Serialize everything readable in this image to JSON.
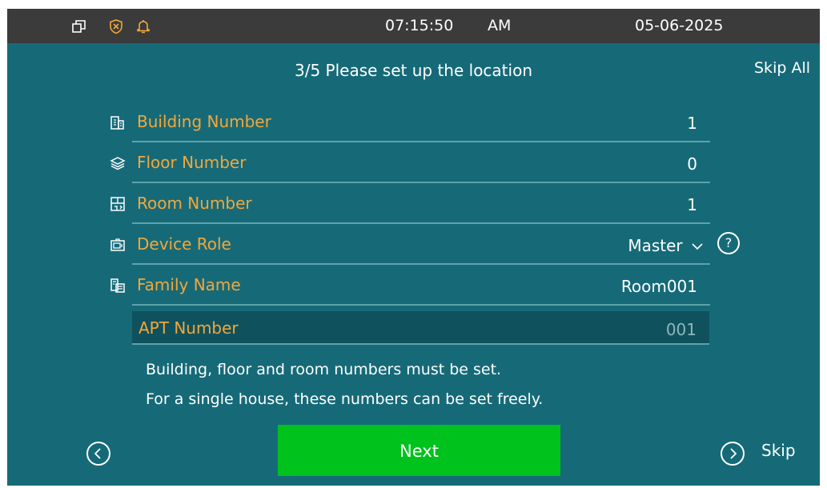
{
  "status_bar": {
    "icons": [
      "window-restore-icon",
      "shield-x-icon",
      "bell-icon"
    ],
    "time": "07:15:50",
    "meridiem": "AM",
    "date": "05-06-2025",
    "icon_colors": {
      "default": "#ffffff",
      "shield": "#f3a73a",
      "bell": "#f3a73a"
    }
  },
  "header": {
    "title": "3/5 Please set up the location",
    "skip_all": "Skip All"
  },
  "form": {
    "building": {
      "label": "Building Number",
      "value": "1",
      "icon": "building-icon"
    },
    "floor": {
      "label": "Floor Number",
      "value": "0",
      "icon": "layers-icon"
    },
    "room": {
      "label": "Room Number",
      "value": "1",
      "icon": "room-icon"
    },
    "role": {
      "label": "Device Role",
      "value": "Master",
      "icon": "device-icon"
    },
    "family": {
      "label": "Family Name",
      "value": "Room001",
      "icon": "family-icon"
    },
    "apt": {
      "label": "APT Number",
      "value": "001"
    }
  },
  "hints": {
    "line1": "Building, floor and room numbers must be set.",
    "line2": "For a single house, these numbers can be set freely."
  },
  "footer": {
    "next_label": "Next",
    "skip_label": "Skip"
  },
  "colors": {
    "background": "#166a78",
    "label": "#f3a73a",
    "next_button": "#00c21c",
    "status_bar": "#3b3b3b"
  }
}
